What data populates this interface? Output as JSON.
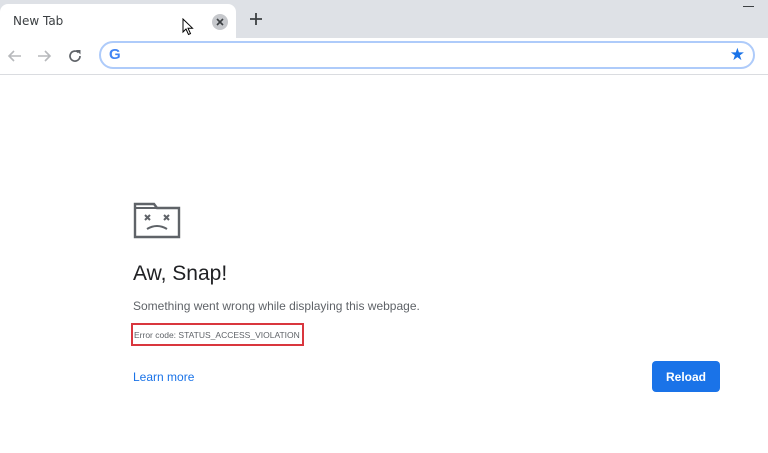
{
  "browser": {
    "tab": {
      "title": "New Tab"
    },
    "omnibox": {
      "value": ""
    },
    "icons": {
      "back": "arrow-left-icon",
      "forward": "arrow-right-icon",
      "reload": "reload-icon",
      "google": "google-g-icon",
      "bookmark": "star-icon",
      "close_tab": "close-icon",
      "new_tab": "plus-icon",
      "minimize": "minimize-icon"
    },
    "google_letter": "G"
  },
  "error_page": {
    "heading": "Aw, Snap!",
    "message": "Something went wrong while displaying this webpage.",
    "error_code": "Error code: STATUS_ACCESS_VIOLATION",
    "learn_more": "Learn more",
    "reload": "Reload",
    "icon": "sad-tab-icon"
  },
  "colors": {
    "accent": "#1a73e8",
    "highlight": "#d9363e",
    "tabstrip": "#dee1e6"
  }
}
